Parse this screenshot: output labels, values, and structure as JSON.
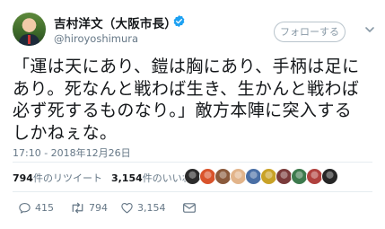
{
  "tweet": {
    "display_name": "吉村洋文（大阪市長）",
    "handle": "@hiroyoshimura",
    "follow_label": "フォローする",
    "text": "「運は天にあり、鎧は胸にあり、手柄は足に\nあり。死なんと戦わば生き、生かんと戦わば\n必ず死するものなり。」敵方本陣に突入する\nしかねぇな。",
    "timestamp": "17:10 - 2018年12月26日",
    "retweet_count": "794",
    "retweet_label": "件のリツイート",
    "like_count": "3,154",
    "like_label": "件のいいね",
    "actions": {
      "reply_count": "415",
      "retweet_count": "794",
      "like_count": "3,154"
    }
  },
  "colors": {
    "verified": "#1da1f2",
    "muted": "#657786",
    "text": "#14171a",
    "divider": "#e6ecf0"
  },
  "likers": [
    "#2b2b2b",
    "#d9532b",
    "#8a5a3c",
    "#e2b48a",
    "#4a6fa5",
    "#c9a227",
    "#7a3b3b",
    "#3d7a4d",
    "#b0413e",
    "#262626"
  ],
  "icons": {
    "verified": "verified-badge-icon",
    "caret": "chevron-down-icon",
    "reply": "reply-icon",
    "retweet": "retweet-icon",
    "like": "heart-icon",
    "dm": "mail-icon"
  }
}
